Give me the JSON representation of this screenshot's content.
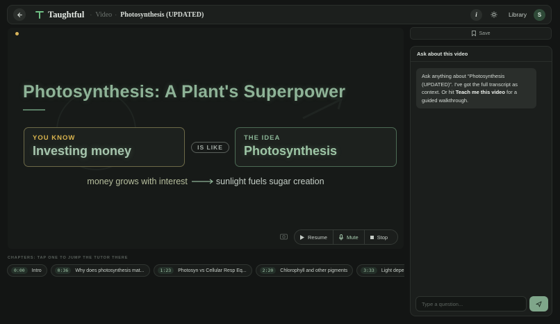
{
  "header": {
    "brand": "Taughtful",
    "breadcrumb_section": "Video",
    "breadcrumb_title": "Photosynthesis (UPDATED)",
    "info_label": "i",
    "library_label": "Library",
    "avatar_initial": "S"
  },
  "slide": {
    "title": "Photosynthesis: A Plant's Superpower",
    "known_label": "YOU KNOW",
    "known_value": "Investing money",
    "connector": "IS LIKE",
    "idea_label": "THE IDEA",
    "idea_value": "Photosynthesis",
    "relation_left": "money grows with interest",
    "relation_right": "sunlight fuels sugar creation"
  },
  "controls": {
    "resume": "Resume",
    "mute": "Mute",
    "stop": "Stop"
  },
  "chapters": {
    "label": "CHAPTERS: TAP ONE TO JUMP THE TUTOR THERE",
    "items": [
      {
        "time": "0:00",
        "title": "Intro"
      },
      {
        "time": "0:36",
        "title": "Why does photosynthesis mat..."
      },
      {
        "time": "1:23",
        "title": "Photosyn vs Cellular Resp Eq..."
      },
      {
        "time": "2:20",
        "title": "Chlorophyll and other pigments"
      },
      {
        "time": "3:33",
        "title": "Light depende"
      }
    ]
  },
  "save": {
    "label": "Save"
  },
  "chat": {
    "header": "Ask about this video",
    "message_part1": "Ask anything about “Photosynthesis (UPDATED)”. I've got the full transcript as context. Or hit ",
    "message_bold": "Teach me this video",
    "message_part2": " for a guided walkthrough.",
    "input_placeholder": "Type a question..."
  },
  "colors": {
    "accent_green": "#7fa68a",
    "title_green": "#8eb397",
    "gold": "#d9b44e",
    "background": "#131514"
  }
}
